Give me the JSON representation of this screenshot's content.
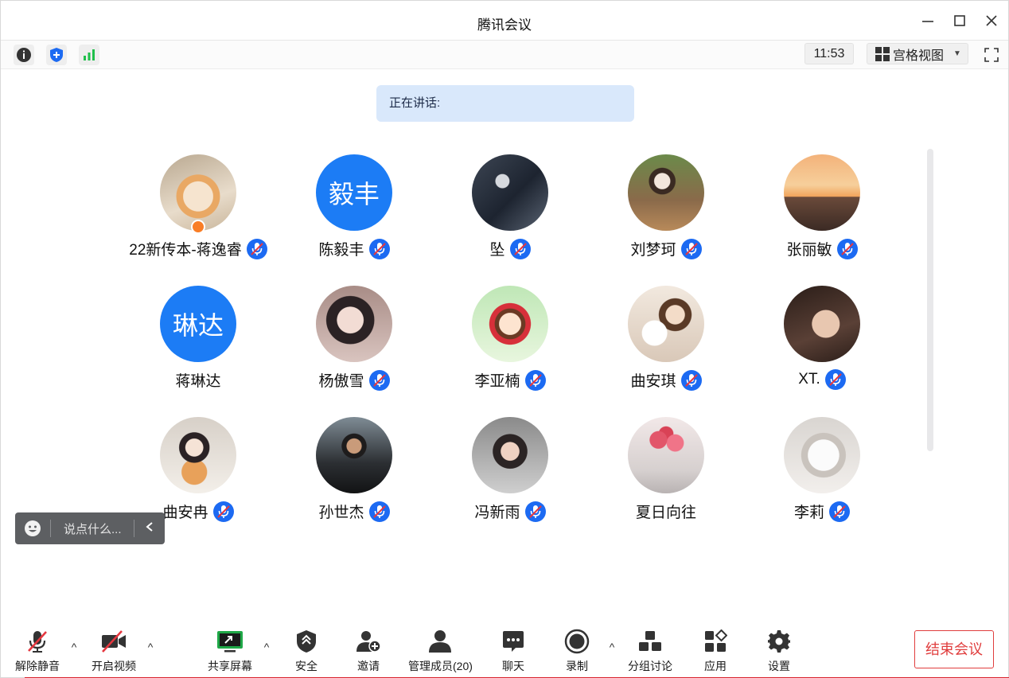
{
  "window": {
    "title": "腾讯会议"
  },
  "topbar": {
    "clock": "11:53",
    "view_mode": "宫格视图"
  },
  "speaking": {
    "label": "正在讲话:"
  },
  "participants": [
    {
      "name": "22新传本-蒋逸睿",
      "avatar_kind": "photo",
      "photo": "cat",
      "host": true,
      "muted": true
    },
    {
      "name": "陈毅丰",
      "avatar_kind": "text",
      "avatar_text": "毅丰",
      "muted": true
    },
    {
      "name": "坠",
      "avatar_kind": "photo",
      "photo": "dark",
      "muted": true
    },
    {
      "name": "刘梦珂",
      "avatar_kind": "photo",
      "photo": "outdoor",
      "muted": true
    },
    {
      "name": "张丽敏",
      "avatar_kind": "photo",
      "photo": "sunset",
      "muted": true
    },
    {
      "name": "蒋琳达",
      "avatar_kind": "text",
      "avatar_text": "琳达",
      "muted": false
    },
    {
      "name": "杨傲雪",
      "avatar_kind": "photo",
      "photo": "girl",
      "muted": true
    },
    {
      "name": "李亚楠",
      "avatar_kind": "photo",
      "photo": "cartoon",
      "muted": true
    },
    {
      "name": "曲安琪",
      "avatar_kind": "photo",
      "photo": "dog",
      "muted": true
    },
    {
      "name": "XT.",
      "avatar_kind": "photo",
      "photo": "portrait",
      "muted": true
    },
    {
      "name": "曲安冉",
      "avatar_kind": "photo",
      "photo": "kitten",
      "muted": true
    },
    {
      "name": "孙世杰",
      "avatar_kind": "photo",
      "photo": "boy",
      "muted": true
    },
    {
      "name": "冯新雨",
      "avatar_kind": "photo",
      "photo": "selfie",
      "muted": true
    },
    {
      "name": "夏日向往",
      "avatar_kind": "photo",
      "photo": "flowers",
      "muted": false
    },
    {
      "name": "李莉",
      "avatar_kind": "photo",
      "photo": "whitecat",
      "muted": true
    }
  ],
  "chat": {
    "placeholder": "说点什么..."
  },
  "toolbar": {
    "unmute": "解除静音",
    "video": "开启视频",
    "share": "共享屏幕",
    "security": "安全",
    "invite": "邀请",
    "members": "管理成员(20)",
    "chat": "聊天",
    "record": "录制",
    "breakout": "分组讨论",
    "apps": "应用",
    "settings": "设置",
    "end": "结束会议"
  },
  "colors": {
    "accent": "#1c7cf5",
    "end": "#e03d3d",
    "speaking_bg": "#d9e8fb"
  }
}
